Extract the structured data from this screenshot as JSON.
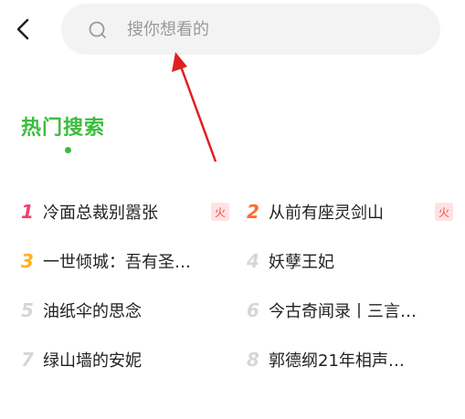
{
  "header": {
    "search_placeholder": "搜你想看的"
  },
  "hot_search": {
    "title": "热门搜索",
    "badge_label": "火",
    "items": [
      {
        "rank": "1",
        "title": "冷面总裁别嚣张",
        "badge": true
      },
      {
        "rank": "2",
        "title": "从前有座灵剑山",
        "badge": true
      },
      {
        "rank": "3",
        "title": "一世倾城：吾有圣…",
        "badge": false
      },
      {
        "rank": "4",
        "title": "妖孽王妃",
        "badge": false
      },
      {
        "rank": "5",
        "title": "油纸伞的思念",
        "badge": false
      },
      {
        "rank": "6",
        "title": "今古奇闻录丨三言…",
        "badge": false
      },
      {
        "rank": "7",
        "title": "绿山墙的安妮",
        "badge": false
      },
      {
        "rank": "8",
        "title": "郭德纲21年相声…",
        "badge": false
      }
    ]
  },
  "colors": {
    "accent": "#3bbd3f",
    "rank1": "#f0416b",
    "rank2": "#ff6a2a",
    "rank3": "#ffb01f",
    "rank_other": "#d6d6d6",
    "arrow": "#e02020"
  },
  "icons": {
    "back": "chevron-left-icon",
    "search": "search-icon",
    "hot": "fire-badge"
  }
}
